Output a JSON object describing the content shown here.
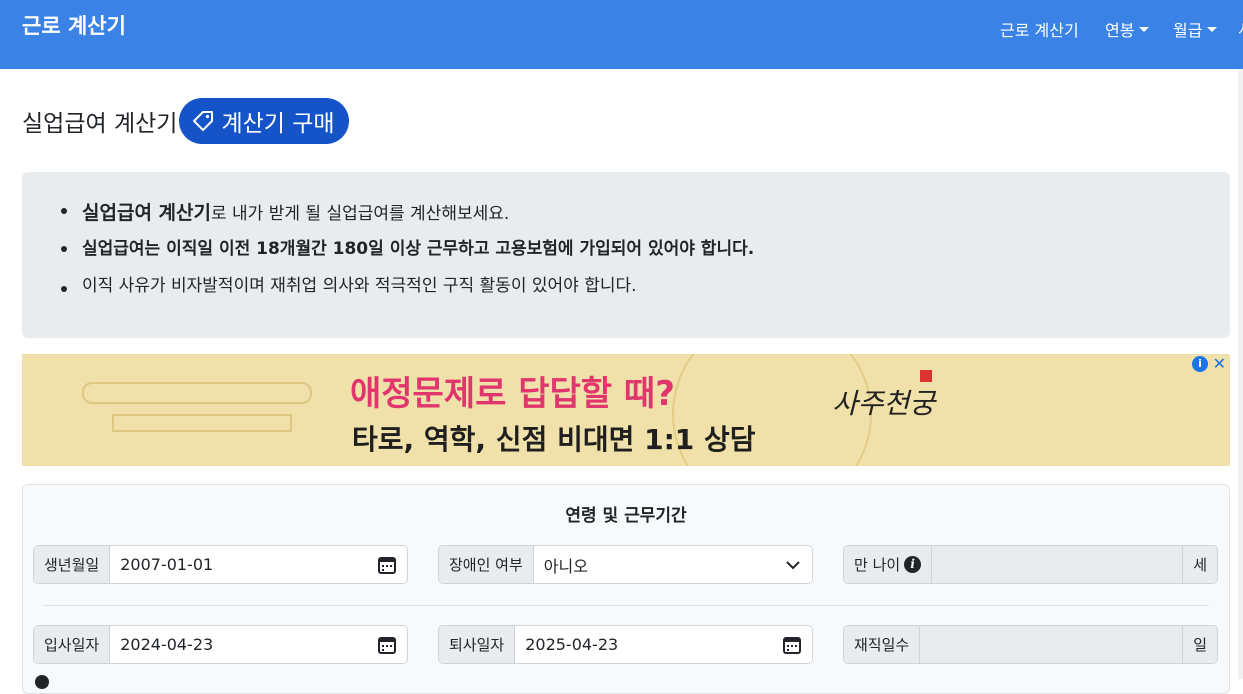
{
  "navbar": {
    "brand": "근로 계산기",
    "items": [
      {
        "label": "근로 계산기",
        "dropdown": false
      },
      {
        "label": "연봉",
        "dropdown": true
      },
      {
        "label": "월급",
        "dropdown": true
      }
    ],
    "edge_fragment": "시"
  },
  "header": {
    "title": "실업급여 계산기",
    "buy_label": "계산기 구매"
  },
  "info": {
    "item1_bold": "실업급여 계산기",
    "item1_rest": "로 내가 받게 될 실업급여를 계산해보세요.",
    "item2": "실업급여는 이직일 이전 18개월간 180일 이상 근무하고 고용보험에 가입되어 있어야 합니다.",
    "item3": "이직 사유가 비자발적이며 재취업 의사와 적극적인 구직 활동이 있어야 합니다."
  },
  "ad": {
    "headline": "애정문제로 답답할 때?",
    "subline": "타로, 역학, 신점 비대면 1:1 상담",
    "logo": "사주천궁"
  },
  "form": {
    "section_title": "연령 및 근무기간",
    "birth": {
      "label": "생년월일",
      "value": "2007-01-01"
    },
    "disabled": {
      "label": "장애인 여부",
      "value": "아니오"
    },
    "age": {
      "label": "만 나이",
      "value": "",
      "unit": "세"
    },
    "hire": {
      "label": "입사일자",
      "value": "2024-04-23"
    },
    "leave": {
      "label": "퇴사일자",
      "value": "2025-04-23"
    },
    "days": {
      "label": "재직일수",
      "value": "",
      "unit": "일"
    }
  },
  "colors": {
    "navbar": "#3a82e6",
    "badge": "#1554c8",
    "ad_headline": "#e1356e"
  }
}
